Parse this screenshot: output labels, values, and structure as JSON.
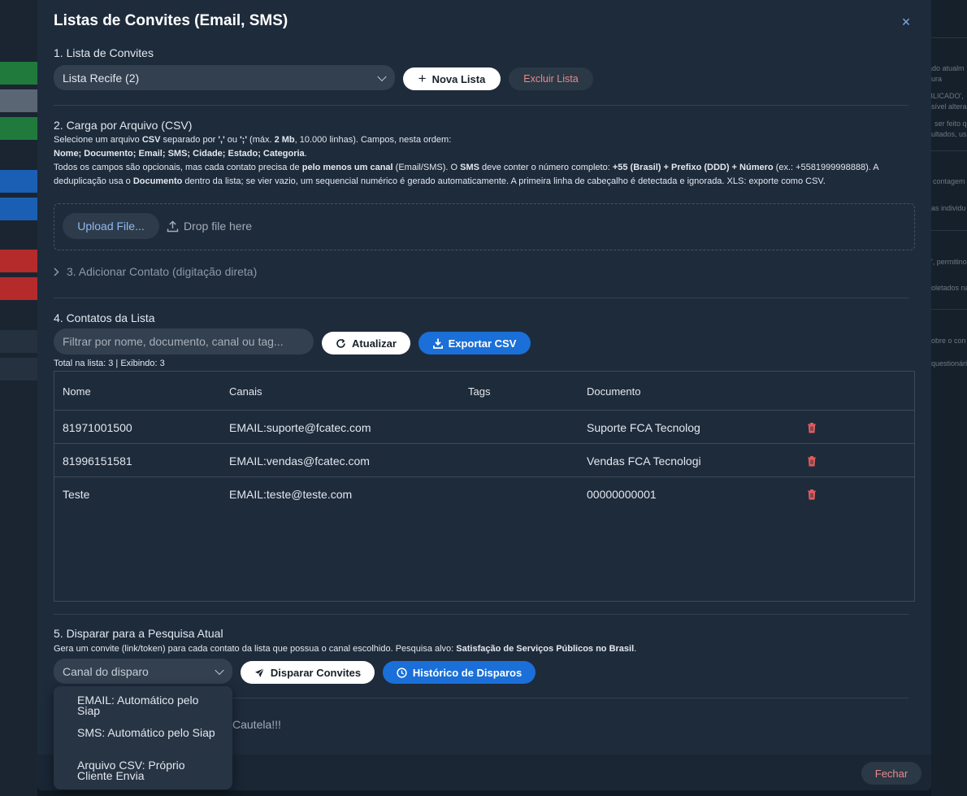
{
  "background": {
    "right_fragments": [
      "ado atualm",
      "ura",
      "BLICADO',",
      "sível altera",
      "ser feito q",
      "ultados, us",
      "contagem",
      "as individu",
      "', permitino",
      "oletados na",
      "obre o con",
      "questionári"
    ]
  },
  "modal": {
    "title": "Listas de Convites (Email, SMS)",
    "close_icon": "×"
  },
  "section1": {
    "title": "1. Lista de Convites",
    "selected_list": "Lista Recife (2)",
    "new_list_label": "Nova Lista",
    "delete_list_label": "Excluir Lista"
  },
  "section2": {
    "title": "2. Carga por Arquivo (CSV)",
    "desc_l1_a": "Selecione um arquivo ",
    "desc_l1_b": "CSV",
    "desc_l1_c": " separado por ",
    "desc_l1_d": "','",
    "desc_l1_e": " ou ",
    "desc_l1_f": "';'",
    "desc_l1_g": " (máx. ",
    "desc_l1_h": "2 Mb",
    "desc_l1_i": ", 10.000 linhas). Campos, nesta ordem:",
    "desc_l2": "Nome; Documento; Email; SMS; Cidade; Estado; Categoria",
    "desc_l2_end": ".",
    "desc_l3_a": "Todos os campos são opcionais, mas cada contato precisa de ",
    "desc_l3_b": "pelo menos um canal",
    "desc_l3_c": " (Email/SMS). O ",
    "desc_l3_d": "SMS",
    "desc_l3_e": " deve conter o número completo: ",
    "desc_l3_f": "+55 (Brasil) + Prefixo (DDD) + Número",
    "desc_l3_g": " (ex.: +5581999998888). A deduplicação usa o ",
    "desc_l3_h": "Documento",
    "desc_l3_i": " dentro da lista; se vier vazio, um sequencial numérico é gerado automaticamente. A primeira linha de cabeçalho é detectada e ignorada. XLS: exporte como CSV.",
    "upload_label": "Upload File...",
    "drop_label": "Drop file here"
  },
  "section3": {
    "title": "3. Adicionar Contato (digitação direta)"
  },
  "section4": {
    "title": "4. Contatos da Lista",
    "filter_placeholder": "Filtrar por nome, documento, canal ou tag...",
    "refresh_label": "Atualizar",
    "export_label": "Exportar CSV",
    "total_text": "Total na lista: 3 | Exibindo: 3",
    "columns": [
      "Nome",
      "Canais",
      "Tags",
      "Documento"
    ],
    "rows": [
      {
        "nome": "81971001500",
        "canais": "EMAIL:suporte@fcatec.com",
        "tags": "",
        "documento": "Suporte FCA Tecnolog"
      },
      {
        "nome": "81996151581",
        "canais": "EMAIL:vendas@fcatec.com",
        "tags": "",
        "documento": "Vendas FCA Tecnologi"
      },
      {
        "nome": "Teste",
        "canais": "EMAIL:teste@teste.com",
        "tags": "",
        "documento": "00000000001"
      }
    ]
  },
  "section5": {
    "title": "5. Disparar para a Pesquisa Atual",
    "desc_a": "Gera um convite (link/token) para cada contato da lista que possua o canal escolhido. Pesquisa alvo: ",
    "desc_b": "Satisfação de Serviços Públicos no Brasil",
    "desc_c": ".",
    "channel_placeholder": "Canal do disparo",
    "dispatch_label": "Disparar Convites",
    "history_label": "Histórico de Disparos",
    "channel_options": [
      "EMAIL: Automático pelo Siap",
      "SMS: Automático pelo Siap",
      "Arquivo CSV: Próprio Cliente Envia"
    ],
    "caution_text": "Cautela!!!"
  },
  "footer": {
    "close_label": "Fechar"
  },
  "colors": {
    "accent_blue": "#1a6fd8",
    "danger_red": "#e98a8a",
    "modal_bg": "#1e2b3b"
  }
}
